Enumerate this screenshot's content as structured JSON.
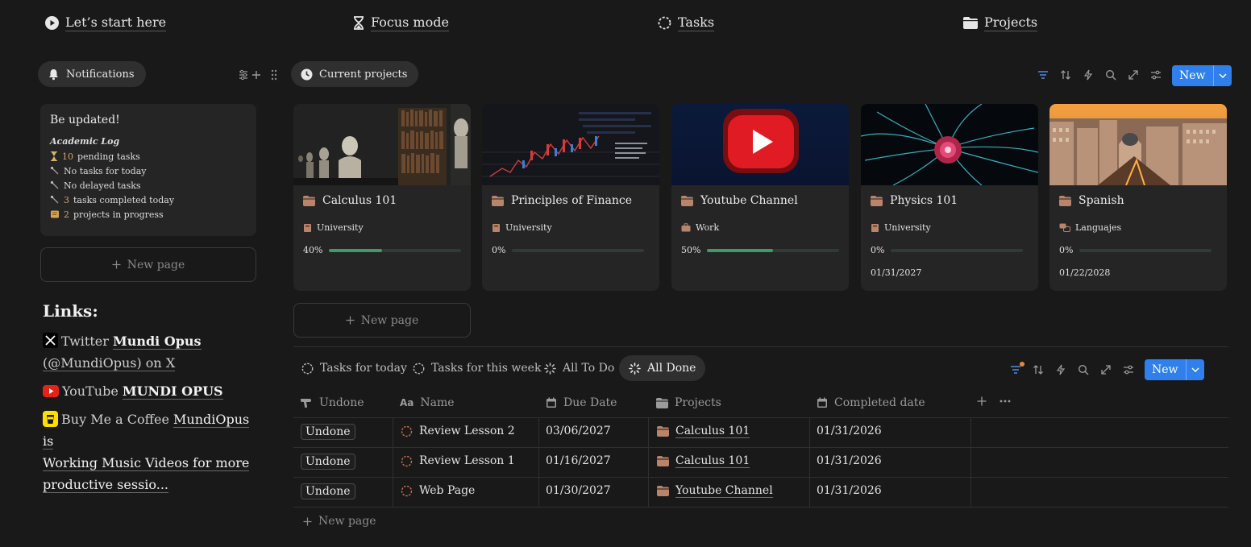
{
  "topnav": [
    {
      "label": "Let’s start here",
      "icon": "play-circle-icon"
    },
    {
      "label": "Focus mode",
      "icon": "hourglass-icon"
    },
    {
      "label": "Tasks",
      "icon": "dashed-circle-icon"
    },
    {
      "label": "Projects",
      "icon": "folder-icon"
    }
  ],
  "sidebar": {
    "notifications_label": "Notifications",
    "callout": {
      "title": "Be updated!",
      "subtitle": "Academic Log",
      "rows": [
        {
          "num": "10",
          "text": "pending tasks",
          "icon": "hourglass-icon"
        },
        {
          "num": "",
          "text": "No tasks for today",
          "icon": "pin-icon"
        },
        {
          "num": "",
          "text": "No delayed tasks",
          "icon": "pin-icon"
        },
        {
          "num": "3",
          "text": "tasks completed today",
          "icon": "pin-icon"
        },
        {
          "num": "2",
          "text": "projects in progress",
          "icon": "scroll-icon"
        }
      ]
    },
    "new_page": "New page",
    "links_title": "Links:",
    "links": {
      "twitter_prefix": "Twitter",
      "twitter_bold": "Mundi Opus",
      "twitter_rest": "(@MundiOpus) on X",
      "youtube_prefix": "YouTube",
      "youtube_bold": "MUNDI OPUS",
      "coffee_prefix": "Buy Me a Coffee",
      "coffee_link1": "MundiOpus is",
      "coffee_link2": "Working Music Videos for more",
      "coffee_link3": "productive sessio..."
    }
  },
  "projects": {
    "view_label": "Current projects",
    "new_button": "New",
    "new_page": "New page",
    "cards": [
      {
        "title": "Calculus 101",
        "tag": "University",
        "progress_label": "40%",
        "progress": 0.4,
        "date": ""
      },
      {
        "title": "Principles of Finance",
        "tag": "University",
        "progress_label": "0%",
        "progress": 0,
        "date": ""
      },
      {
        "title": "Youtube Channel",
        "tag": "Work",
        "progress_label": "50%",
        "progress": 0.5,
        "date": ""
      },
      {
        "title": "Physics 101",
        "tag": "University",
        "progress_label": "0%",
        "progress": 0,
        "date": "01/31/2027"
      },
      {
        "title": "Spanish",
        "tag": "Languajes",
        "progress_label": "0%",
        "progress": 0,
        "date": "01/22/2028"
      }
    ]
  },
  "tasks": {
    "tabs": [
      "Tasks for today",
      "Tasks for this week",
      "All To Do",
      "All Done"
    ],
    "active_tab": "All Done",
    "new_button": "New",
    "columns": [
      "Undone",
      "Name",
      "Due Date",
      "Projects",
      "Completed date"
    ],
    "rows": [
      {
        "status": "Undone",
        "name": "Review Lesson 2",
        "due": "03/06/2027",
        "project": "Calculus 101",
        "completed": "01/31/2026"
      },
      {
        "status": "Undone",
        "name": "Review Lesson 1",
        "due": "01/16/2027",
        "project": "Calculus 101",
        "completed": "01/31/2026"
      },
      {
        "status": "Undone",
        "name": "Web Page",
        "due": "01/30/2027",
        "project": "Youtube Channel",
        "completed": "01/31/2026"
      }
    ],
    "new_page": "New page"
  },
  "colors": {
    "background": "#191919",
    "card": "#252525",
    "accent": "#2f80ed",
    "progress": "#3f9b66",
    "folder": "#b9846a"
  }
}
